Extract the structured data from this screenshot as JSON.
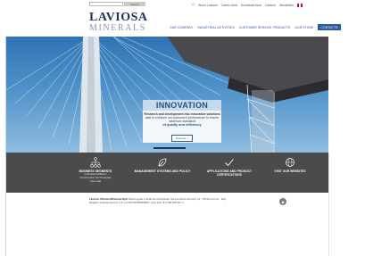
{
  "topbar": {
    "search_placeholder": "",
    "search_button": "Search",
    "links": [
      "About Laviosa",
      "Career Area",
      "Download Area",
      "Careers",
      "Newsletter"
    ],
    "flag_colors": [
      "#c8102e",
      "#ffffff",
      "#c8102e"
    ]
  },
  "logo": {
    "main": "LAVIOSA",
    "sub": "MINERALS"
  },
  "nav": {
    "items": [
      "OUR COMPANY",
      "INDUSTRIAL ACTIVITIES",
      "CUSTOMER SERVICE PRODUCTS",
      "OUR STORE",
      "CONTACTS"
    ]
  },
  "hero": {
    "title": "INNOVATION",
    "line1": "Research and development into innovative solutions",
    "line2": "able to enhance our customer's performance to ensure maximum standards",
    "line3": "of quality and efficiency",
    "button": "Discover +"
  },
  "features": [
    {
      "icon": "network-icon",
      "title": "BUSINESS SEGMENTS",
      "sub": [
        "Industrial Additives",
        "Construction Technologies",
        "Care Mat"
      ]
    },
    {
      "icon": "leaf-icon",
      "title": "MANAGEMENT SYSTEMS AND POLICY",
      "sub": []
    },
    {
      "icon": "check-icon",
      "title": "APPLICATIONS AND PRODUCT CERTIFICATIONS",
      "sub": []
    },
    {
      "icon": "globe-icon",
      "title": "VISIT OUR WEBSITES",
      "sub": []
    }
  ],
  "footer": {
    "company": "Laviosa Chimica Mineraria SpA",
    "address": " Sede Legale e Sede Amministrativa: Via Leonardo da Vinci, 21 - 57123 Livorno - Italy",
    "registry": "Registro Imprese Livorno C.F. e P.IVA 01235640509 - Cap. Soc. € 5.740.000,00 i.v."
  },
  "colors": {
    "brand_navy": "#1f3464",
    "nav_blue": "#2d4a86",
    "accent": "#2c5aa0",
    "band": "#4b4b4b"
  }
}
